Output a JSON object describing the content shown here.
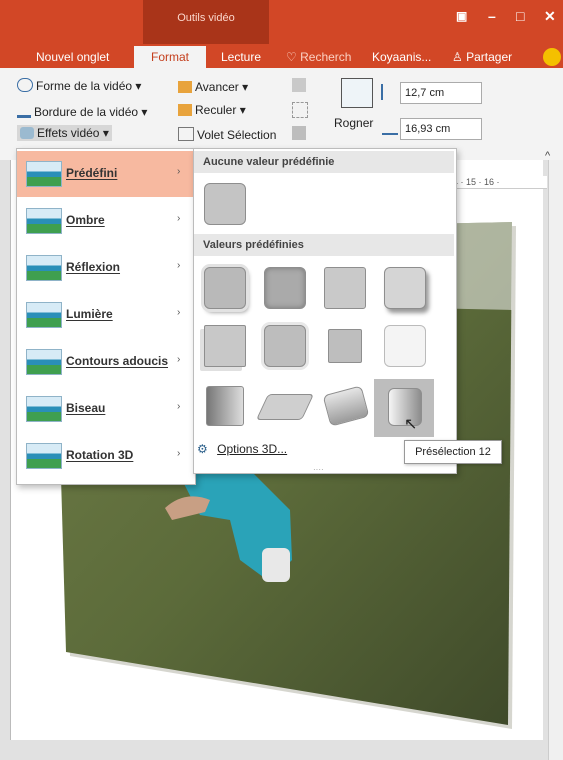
{
  "window": {
    "context_title": "Outils vidéo",
    "buttons": {
      "restore": "▣",
      "minimize": "–",
      "maximize": "□",
      "close": "✕"
    }
  },
  "tabs": {
    "nouvel_onglet": "Nouvel onglet",
    "format": "Format",
    "lecture": "Lecture",
    "search_placeholder": "Recherch",
    "user": "Koyaanis...",
    "share": "Partager"
  },
  "ribbon": {
    "forme": "Forme de la vidéo",
    "bordure": "Bordure de la vidéo",
    "effets": "Effets vidéo",
    "avancer": "Avancer",
    "reculer": "Reculer",
    "volet": "Volet Sélection",
    "rogner": "Rogner",
    "height_value": "12,7 cm",
    "width_value": "16,93 cm"
  },
  "menu": {
    "items": [
      {
        "label": "Prédéfini"
      },
      {
        "label": "Ombre"
      },
      {
        "label": "Réflexion"
      },
      {
        "label": "Lumière"
      },
      {
        "label": "Contours adoucis"
      },
      {
        "label": "Biseau"
      },
      {
        "label": "Rotation 3D"
      }
    ]
  },
  "gallery": {
    "no_preset_header": "Aucune valeur prédéfinie",
    "presets_header": "Valeurs prédéfinies",
    "options_3d": "Options 3D...",
    "tooltip": "Présélection 12"
  },
  "ruler": {
    "text": "4 · 15 · 16 ·"
  },
  "colors": {
    "accent": "#d24726",
    "context": "#a93419",
    "menu_highlight": "#f7b9a0"
  }
}
